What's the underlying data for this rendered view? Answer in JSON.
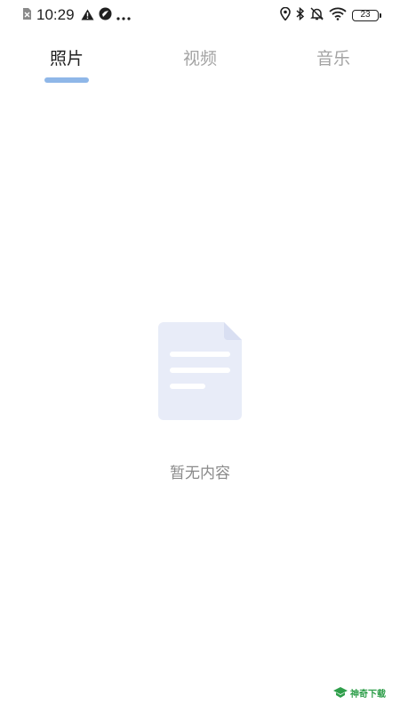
{
  "status_bar": {
    "time": "10:29",
    "battery_level": "23",
    "icons_left": [
      "sim-card-off-icon",
      "warning-icon",
      "app-notification-icon",
      "more-dots-icon"
    ],
    "icons_right": [
      "location-icon",
      "bluetooth-icon",
      "bell-muted-icon",
      "wifi-icon",
      "battery-icon"
    ]
  },
  "tabs": [
    {
      "label": "照片",
      "active": true
    },
    {
      "label": "视频",
      "active": false
    },
    {
      "label": "音乐",
      "active": false
    }
  ],
  "empty_state": {
    "message": "暂无内容",
    "icon": "document-icon"
  },
  "watermark": {
    "text": "神奇下载",
    "icon": "watermark-logo-icon"
  },
  "colors": {
    "active_tab_text": "#1f1f1f",
    "inactive_tab_text": "#a3a3a3",
    "tab_indicator": "#8fb7e8",
    "empty_icon_fill": "#e8ecf8",
    "empty_text": "#8a8a8a",
    "watermark": "#2e9e4a"
  }
}
